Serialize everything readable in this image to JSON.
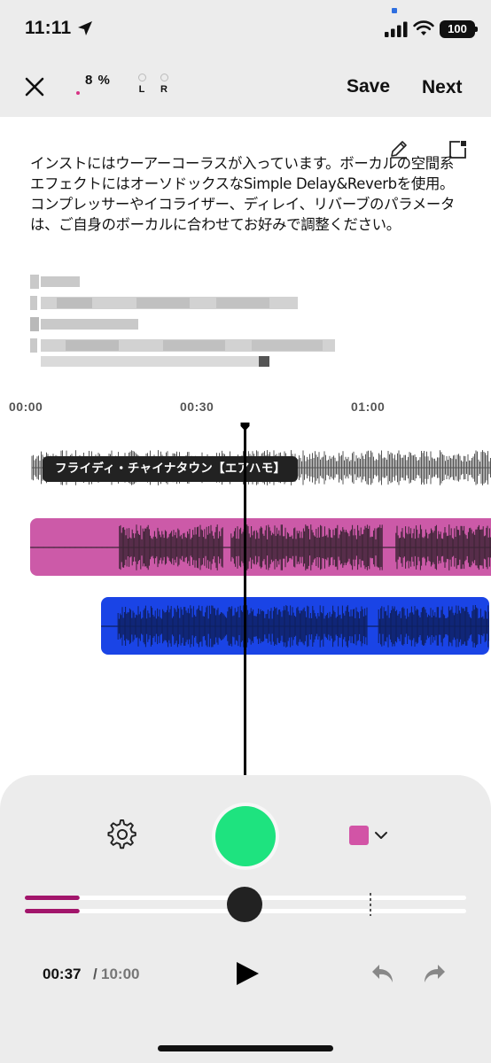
{
  "status_bar": {
    "time": "11:11",
    "battery": "100",
    "icons": [
      "location-arrow-icon",
      "cellular-signal-icon",
      "wifi-icon",
      "battery-icon"
    ]
  },
  "toolbar": {
    "close_icon": "close-icon",
    "level_percent": "8 %",
    "channel_left": "L",
    "channel_right": "R",
    "save_label": "Save",
    "next_label": "Next"
  },
  "description": {
    "text": "インストにはウーアーコーラスが入っています。ボーカルの空間系エフェクトにはオーソドックスなSimple Delay&Reverbを使用。コンプレッサーやイコライザー、ディレイ、リバーブのパラメータは、ご自身のボーカルに合わせてお好みで調整ください。",
    "edit_icon": "pencil-icon",
    "expand_icon": "expand-icon"
  },
  "timeline": {
    "markers": [
      "00:00",
      "00:30",
      "01:00"
    ],
    "track_label": "フライディ・チャイナタウン【エアハモ】",
    "tracks": [
      {
        "kind": "instrumental",
        "color": "#555555"
      },
      {
        "kind": "vocal-take",
        "color": "#cc5aa8"
      },
      {
        "kind": "vocal-take",
        "color": "#1a44e6"
      }
    ]
  },
  "controls": {
    "settings_icon": "gear-icon",
    "record_color": "#1ee37f",
    "track_color": "#d254a6",
    "current_time": "00:37",
    "separator": "/",
    "total_time": "10:00",
    "progress_fraction": 0.062,
    "play_icon": "play-icon",
    "undo_icon": "undo-icon",
    "redo_icon": "redo-icon"
  }
}
